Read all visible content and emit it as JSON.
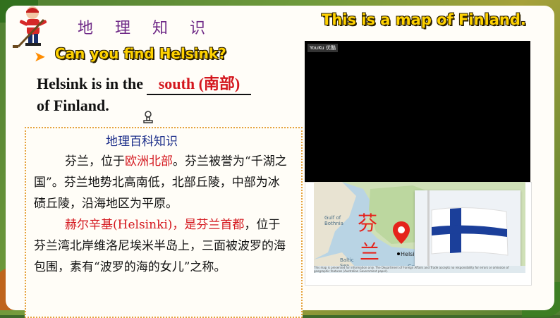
{
  "header": {
    "section_title": "地 理 知 识",
    "map_title": "This is a map of Finland."
  },
  "question": "Can you find Helsink?",
  "sentence": {
    "before": "Helsink is in the",
    "answer": "south (南部)",
    "after": "of Finland."
  },
  "info": {
    "title": "地理百科知识",
    "p1_a": "芬兰，位于",
    "p1_red": "欧洲北部",
    "p1_b": "。芬兰被誉为“千湖之国”。芬兰地势北高南低，北部丘陵，中部为冰碛丘陵，沿海地区为平原。",
    "p2_red": "赫尔辛基(Helsinki)，是芬兰首都",
    "p2_b": "，位于芬兰湾北岸维洛尼埃米半岛上，三面被波罗的海包围，素有“波罗的海的女儿”之称。"
  },
  "map": {
    "video_logo": "YouKu 优酷",
    "char_top": "芬",
    "char_bottom": "兰",
    "labels": [
      "Gulf of Bothnia",
      "Gulf of Finland",
      "Baltic Sea"
    ],
    "city": "Helsinki",
    "note": "This map is presented for information only. The Department of Foreign Affairs and Trade accepts no responsibility for errors or omission of geographic features (Australian Government paper)."
  },
  "colors": {
    "accent_yellow": "#ffd200",
    "accent_red": "#d4171e",
    "title_purple": "#6f2a87",
    "flag_blue": "#003580"
  },
  "icons": [
    "hockey-player-icon",
    "arrow-icon",
    "pin-icon",
    "location-marker-icon",
    "finland-flag-icon"
  ]
}
